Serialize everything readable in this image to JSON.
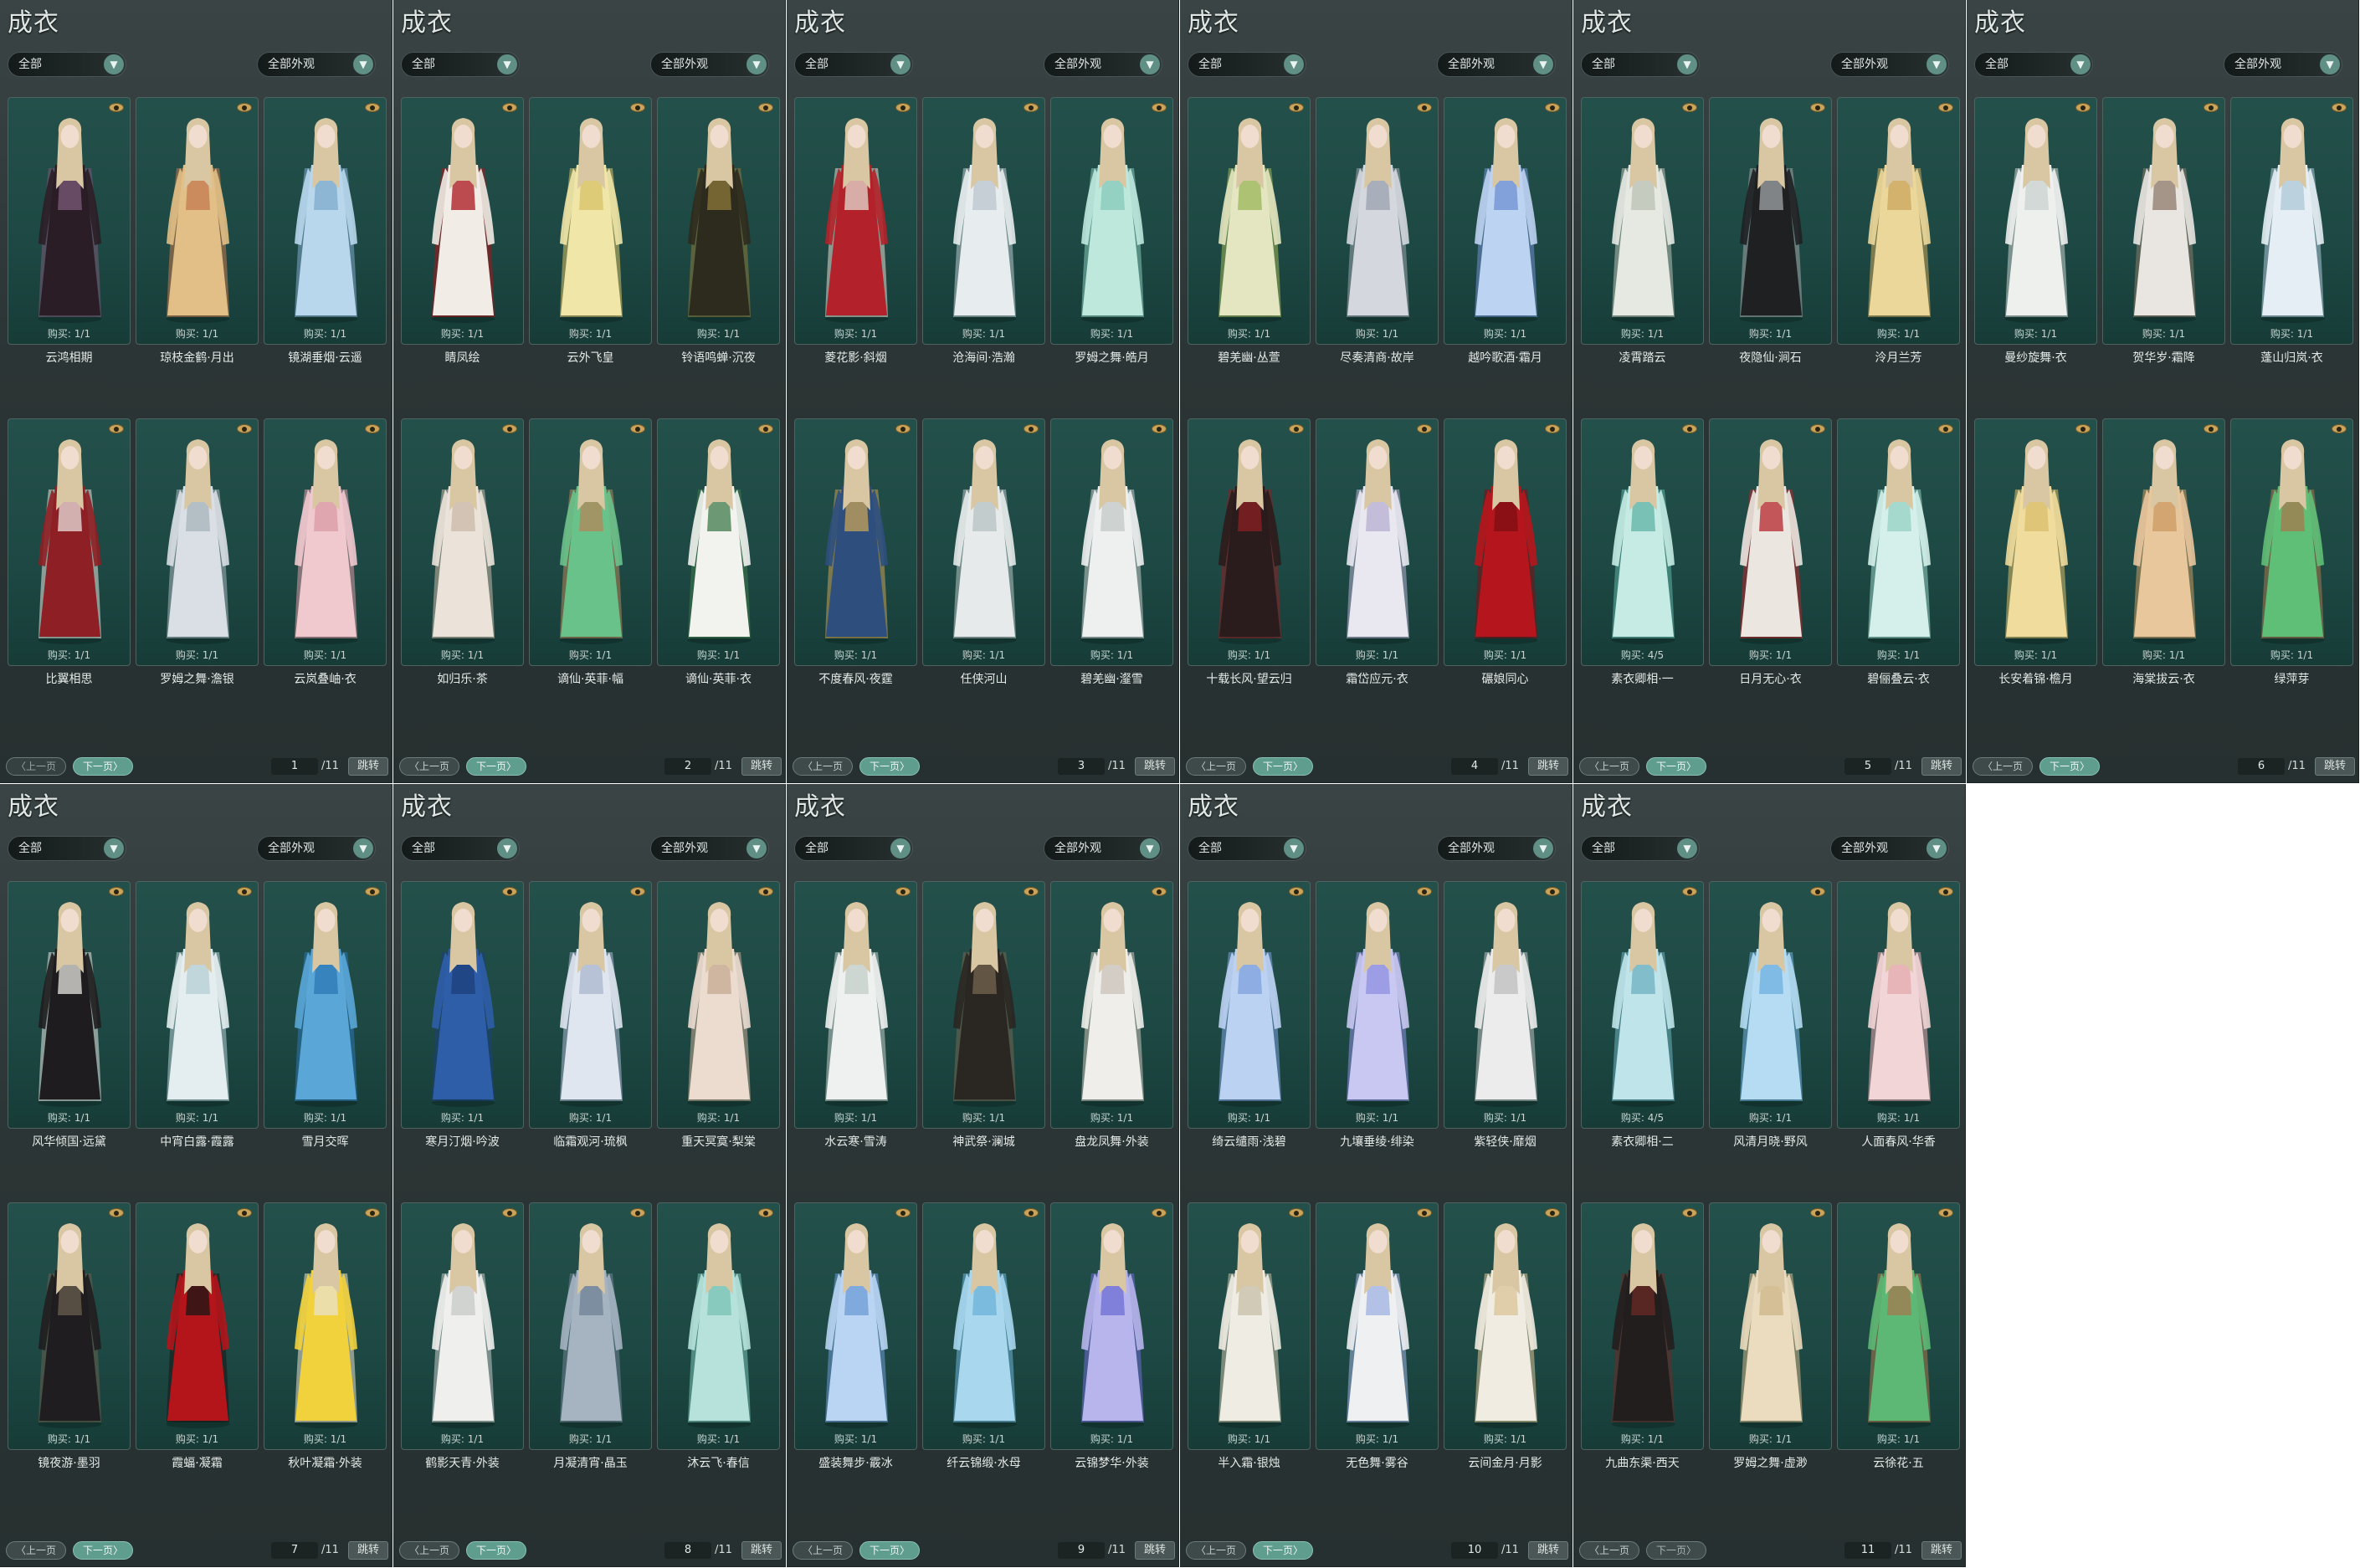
{
  "labels": {
    "title": "成衣",
    "filter_left": "全部",
    "filter_right": "全部外观",
    "prev": "上一页",
    "next": "下一页",
    "jump": "跳转",
    "total": "/11"
  },
  "pages": [
    {
      "page": "1",
      "items": [
        {
          "name": "云鸿相期",
          "buy": "购买: 1/1",
          "colors": [
            "#2a1d26",
            "#7c5a78"
          ]
        },
        {
          "name": "琼枝金鹤·月出",
          "buy": "购买: 1/1",
          "colors": [
            "#e2bf86",
            "#c47a4f"
          ]
        },
        {
          "name": "镜湖垂烟·云遥",
          "buy": "购买: 1/1",
          "colors": [
            "#b8d7ec",
            "#7fa9cc"
          ]
        },
        {
          "name": "比翼相思",
          "buy": "购买: 1/1",
          "colors": [
            "#8e1f24",
            "#e7e2dd"
          ]
        },
        {
          "name": "罗姆之舞·澹银",
          "buy": "购买: 1/1",
          "colors": [
            "#d9dfe4",
            "#a6b3bb"
          ]
        },
        {
          "name": "云岚叠岫·衣",
          "buy": "购买: 1/1",
          "colors": [
            "#f0c9cf",
            "#d99aa6"
          ]
        }
      ]
    },
    {
      "page": "2",
      "items": [
        {
          "name": "睛凤绘",
          "buy": "购买: 1/1",
          "colors": [
            "#f1ece6",
            "#a8161c"
          ]
        },
        {
          "name": "云外飞皇",
          "buy": "购买: 1/1",
          "colors": [
            "#efe6a8",
            "#d7c167"
          ]
        },
        {
          "name": "铃语鸣蝉·沉夜",
          "buy": "购买: 1/1",
          "colors": [
            "#2d2a1e",
            "#8c7a3a"
          ]
        },
        {
          "name": "如归乐·茶",
          "buy": "购买: 1/1",
          "colors": [
            "#ebe3da",
            "#c9b8a7"
          ]
        },
        {
          "name": "谪仙·英菲·幅",
          "buy": "购买: 1/1",
          "colors": [
            "#6ac28b",
            "#b4865a"
          ]
        },
        {
          "name": "谪仙·英菲·衣",
          "buy": "购买: 1/1",
          "colors": [
            "#f2f2ee",
            "#3f7a4b"
          ]
        }
      ]
    },
    {
      "page": "3",
      "items": [
        {
          "name": "菱花影·斜烟",
          "buy": "购买: 1/1",
          "colors": [
            "#b3222a",
            "#e6dcd2"
          ]
        },
        {
          "name": "沧海间·浩瀚",
          "buy": "购买: 1/1",
          "colors": [
            "#e7ecee",
            "#b9c6cc"
          ]
        },
        {
          "name": "罗姆之舞·皓月",
          "buy": "购买: 1/1",
          "colors": [
            "#bfe8dd",
            "#86c9b8"
          ]
        },
        {
          "name": "不度春风·夜霆",
          "buy": "购买: 1/1",
          "colors": [
            "#2e4f7e",
            "#c7a35a"
          ]
        },
        {
          "name": "任侠河山",
          "buy": "购买: 1/1",
          "colors": [
            "#e6eaea",
            "#b7c2c2"
          ]
        },
        {
          "name": "碧羌幽·瀣雪",
          "buy": "购买: 1/1",
          "colors": [
            "#eef0ef",
            "#c3cac8"
          ]
        }
      ]
    },
    {
      "page": "4",
      "items": [
        {
          "name": "碧羌幽·丛萱",
          "buy": "购买: 1/1",
          "colors": [
            "#e3e6c0",
            "#9cb55a"
          ]
        },
        {
          "name": "尽奏清商·故岸",
          "buy": "购买: 1/1",
          "colors": [
            "#d4d8de",
            "#9aa2ad"
          ]
        },
        {
          "name": "越吟歌酒·霜月",
          "buy": "购买: 1/1",
          "colors": [
            "#bcd3f1",
            "#6f8fd0"
          ]
        },
        {
          "name": "十载长风·望云归",
          "buy": "购买: 1/1",
          "colors": [
            "#2a1c1c",
            "#8c1f22"
          ]
        },
        {
          "name": "霜岱应元·衣",
          "buy": "购买: 1/1",
          "colors": [
            "#e9e8f1",
            "#b6afd0"
          ]
        },
        {
          "name": "碾娘同心",
          "buy": "购买: 1/1",
          "colors": [
            "#b5161d",
            "#7d0f14"
          ]
        }
      ]
    },
    {
      "page": "5",
      "items": [
        {
          "name": "凌霄踏云",
          "buy": "购买: 1/1",
          "colors": [
            "#e6e8e2",
            "#b9c1b3"
          ]
        },
        {
          "name": "夜隐仙·涧石",
          "buy": "购买: 1/1",
          "colors": [
            "#1f2022",
            "#a3a6a8"
          ]
        },
        {
          "name": "泠月兰芳",
          "buy": "购买: 1/1",
          "colors": [
            "#ecd79a",
            "#c9a65d"
          ]
        },
        {
          "name": "素衣卿相·一",
          "buy": "购买: 4/5",
          "colors": [
            "#c5ebe4",
            "#5fb3a5"
          ]
        },
        {
          "name": "日月无心·衣",
          "buy": "购买: 1/1",
          "colors": [
            "#ece6e0",
            "#b4262b"
          ]
        },
        {
          "name": "碧俪叠云·衣",
          "buy": "购买: 1/1",
          "colors": [
            "#d5f0ea",
            "#96d1c4"
          ]
        }
      ]
    },
    {
      "page": "6",
      "items": [
        {
          "name": "曼纱旋舞·衣",
          "buy": "购买: 1/1",
          "colors": [
            "#eef0ee",
            "#c9d1cd"
          ]
        },
        {
          "name": "贺华岁·霜降",
          "buy": "购买: 1/1",
          "colors": [
            "#e9e6e1",
            "#8d7a6a"
          ]
        },
        {
          "name": "蓬山归岚·衣",
          "buy": "购买: 1/1",
          "colors": [
            "#e4eef4",
            "#aec7d7"
          ]
        },
        {
          "name": "长安着锦·檐月",
          "buy": "购买: 1/1",
          "colors": [
            "#f0dc9c",
            "#d8bd6b"
          ]
        },
        {
          "name": "海棠拔云·衣",
          "buy": "购买: 1/1",
          "colors": [
            "#e9c79d",
            "#c99a63"
          ]
        },
        {
          "name": "绿萍芽",
          "buy": "购买: 1/1",
          "colors": [
            "#5fbf77",
            "#a6784d"
          ]
        }
      ]
    },
    {
      "page": "7",
      "items": [
        {
          "name": "风华倾国·远黛",
          "buy": "购买: 1/1",
          "colors": [
            "#1e1c1e",
            "#e8e6e2"
          ]
        },
        {
          "name": "中宵白露·霞露",
          "buy": "购买: 1/1",
          "colors": [
            "#e4eef0",
            "#b5cdd3"
          ]
        },
        {
          "name": "雪月交晖",
          "buy": "购买: 1/1",
          "colors": [
            "#5aa6d6",
            "#2c77b4"
          ]
        },
        {
          "name": "镜夜游·墨羽",
          "buy": "购买: 1/1",
          "colors": [
            "#1f1d1f",
            "#6a5f4f"
          ]
        },
        {
          "name": "霞蝠·凝霜",
          "buy": "购买: 1/1",
          "colors": [
            "#b3151b",
            "#1a1616"
          ]
        },
        {
          "name": "秋叶凝霜·外装",
          "buy": "购买: 1/1",
          "colors": [
            "#f2d23c",
            "#e9e2ce"
          ]
        }
      ]
    },
    {
      "page": "8",
      "items": [
        {
          "name": "寒月汀烟·吟波",
          "buy": "购买: 1/1",
          "colors": [
            "#2f5ea8",
            "#1c3f7a"
          ]
        },
        {
          "name": "临霜观河·琉枫",
          "buy": "购买: 1/1",
          "colors": [
            "#dfe6f0",
            "#a9b6cf"
          ]
        },
        {
          "name": "重天冥寞·梨棠",
          "buy": "购买: 1/1",
          "colors": [
            "#ecdcd0",
            "#c5a992"
          ]
        },
        {
          "name": "鹤影天青·外装",
          "buy": "购买: 1/1",
          "colors": [
            "#efefed",
            "#c7c9c6"
          ]
        },
        {
          "name": "月凝清宵·晶玉",
          "buy": "购买: 1/1",
          "colors": [
            "#a6b4c2",
            "#6f8294"
          ]
        },
        {
          "name": "沐云飞·春信",
          "buy": "购买: 1/1",
          "colors": [
            "#b7e2db",
            "#79c1b4"
          ]
        }
      ]
    },
    {
      "page": "9",
      "items": [
        {
          "name": "水云寒·雪涛",
          "buy": "购买: 1/1",
          "colors": [
            "#eef1ef",
            "#c3ccc8"
          ]
        },
        {
          "name": "神武祭·澜城",
          "buy": "购买: 1/1",
          "colors": [
            "#2a2622",
            "#756650"
          ]
        },
        {
          "name": "盘龙凤舞·外装",
          "buy": "购买: 1/1",
          "colors": [
            "#f0eeea",
            "#c9c2b8"
          ]
        },
        {
          "name": "盛装舞步·霰冰",
          "buy": "购买: 1/1",
          "colors": [
            "#b9d5f3",
            "#6d99d6"
          ]
        },
        {
          "name": "纤云锦缎·水母",
          "buy": "购买: 1/1",
          "colors": [
            "#a9d7ee",
            "#6cb2d8"
          ]
        },
        {
          "name": "云锦梦华·外装",
          "buy": "购买: 1/1",
          "colors": [
            "#b7b5ec",
            "#6d6ed3"
          ]
        }
      ]
    },
    {
      "page": "10",
      "items": [
        {
          "name": "绮云缱雨·浅碧",
          "buy": "购买: 1/1",
          "colors": [
            "#bcd2f3",
            "#7ea0de"
          ]
        },
        {
          "name": "九壤垂绫·绯染",
          "buy": "购买: 1/1",
          "colors": [
            "#c9c8f2",
            "#8c8fe0"
          ]
        },
        {
          "name": "紫轻侠·靡烟",
          "buy": "购买: 1/1",
          "colors": [
            "#ececec",
            "#bdbdbd"
          ]
        },
        {
          "name": "半入霜·银烛",
          "buy": "购买: 1/1",
          "colors": [
            "#efece3",
            "#c7bfa7"
          ]
        },
        {
          "name": "无色舞·雾谷",
          "buy": "购买: 1/1",
          "colors": [
            "#eef0f2",
            "#9fb1e2"
          ]
        },
        {
          "name": "云间金月·月影",
          "buy": "购买: 1/1",
          "colors": [
            "#f1ece1",
            "#d9c396"
          ]
        }
      ]
    },
    {
      "page": "11",
      "items": [
        {
          "name": "素衣卿相·二",
          "buy": "购买: 4/5",
          "colors": [
            "#bfe4ea",
            "#6cb0c0"
          ]
        },
        {
          "name": "风清月晓·野风",
          "buy": "购买: 1/1",
          "colors": [
            "#b5dcf3",
            "#6fb0e0"
          ]
        },
        {
          "name": "人面春风·华香",
          "buy": "购买: 1/1",
          "colors": [
            "#f2d5d6",
            "#e3a8ae"
          ]
        },
        {
          "name": "九曲东渠·西天",
          "buy": "购买: 1/1",
          "colors": [
            "#221e1e",
            "#6b2a26"
          ]
        },
        {
          "name": "罗姆之舞·虚渺",
          "buy": "购买: 1/1",
          "colors": [
            "#ecdcbf",
            "#cdb68a"
          ]
        },
        {
          "name": "云徐花·五",
          "buy": "购买: 1/1",
          "colors": [
            "#5cb874",
            "#a6784d"
          ]
        }
      ]
    }
  ]
}
